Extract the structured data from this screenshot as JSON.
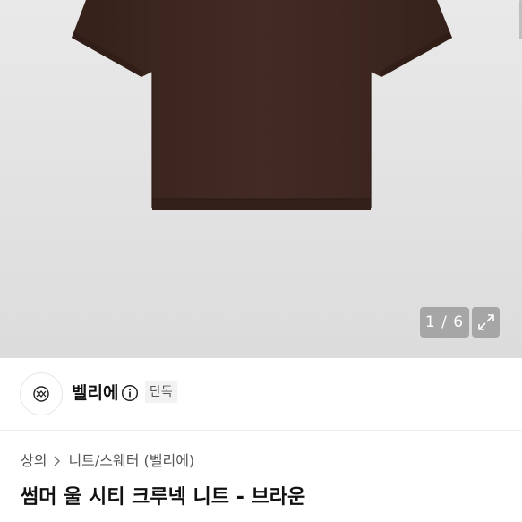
{
  "gallery": {
    "page_current": "1",
    "page_total": "6",
    "page_counter": "1 / 6",
    "product_color": "#3e2722"
  },
  "brand": {
    "name": "벨리에",
    "badge": "단독"
  },
  "breadcrumb": {
    "items": [
      "상의",
      "니트/스웨터 (벨리에)"
    ]
  },
  "product": {
    "title": "썸머 울 시티 크루넥 니트 - 브라운"
  }
}
